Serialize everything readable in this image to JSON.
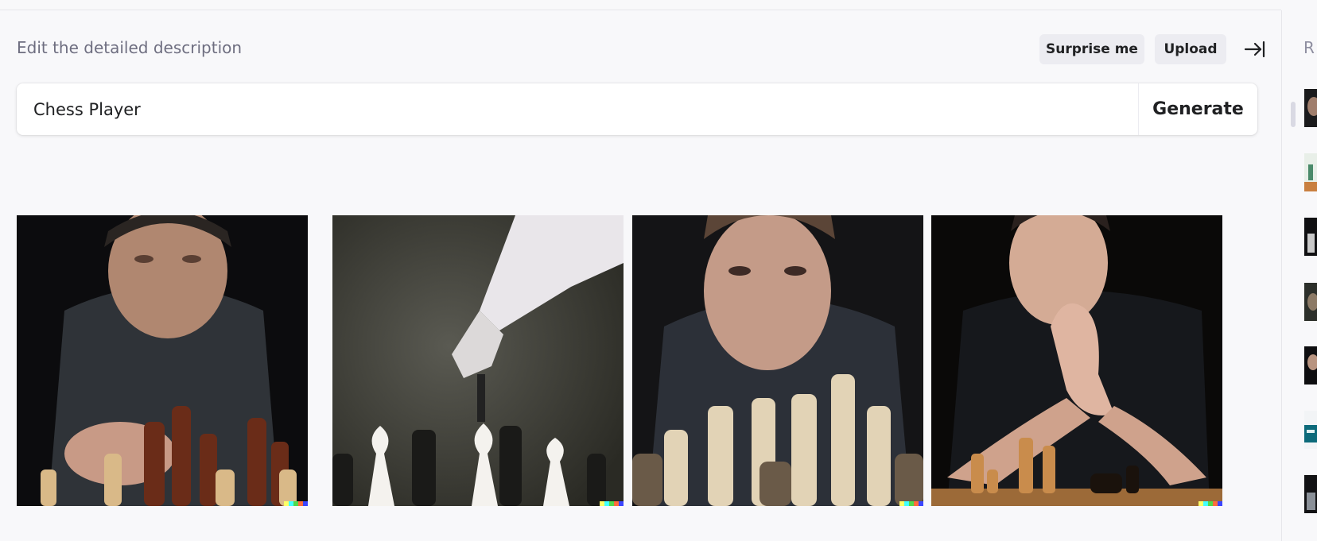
{
  "editor": {
    "hint": "Edit the detailed description",
    "prompt_value": "Chess Player",
    "generate_label": "Generate"
  },
  "actions": {
    "surprise_label": "Surprise me",
    "upload_label": "Upload",
    "collapse_icon": "arrow-right-to-bar-icon"
  },
  "results": {
    "count": 4,
    "watermark_colors": [
      "#ffff66",
      "#42ffff",
      "#51da4c",
      "#ff6e3c",
      "#3c46ff"
    ]
  },
  "sidebar": {
    "title": "R",
    "thumbnail_count": 7
  }
}
